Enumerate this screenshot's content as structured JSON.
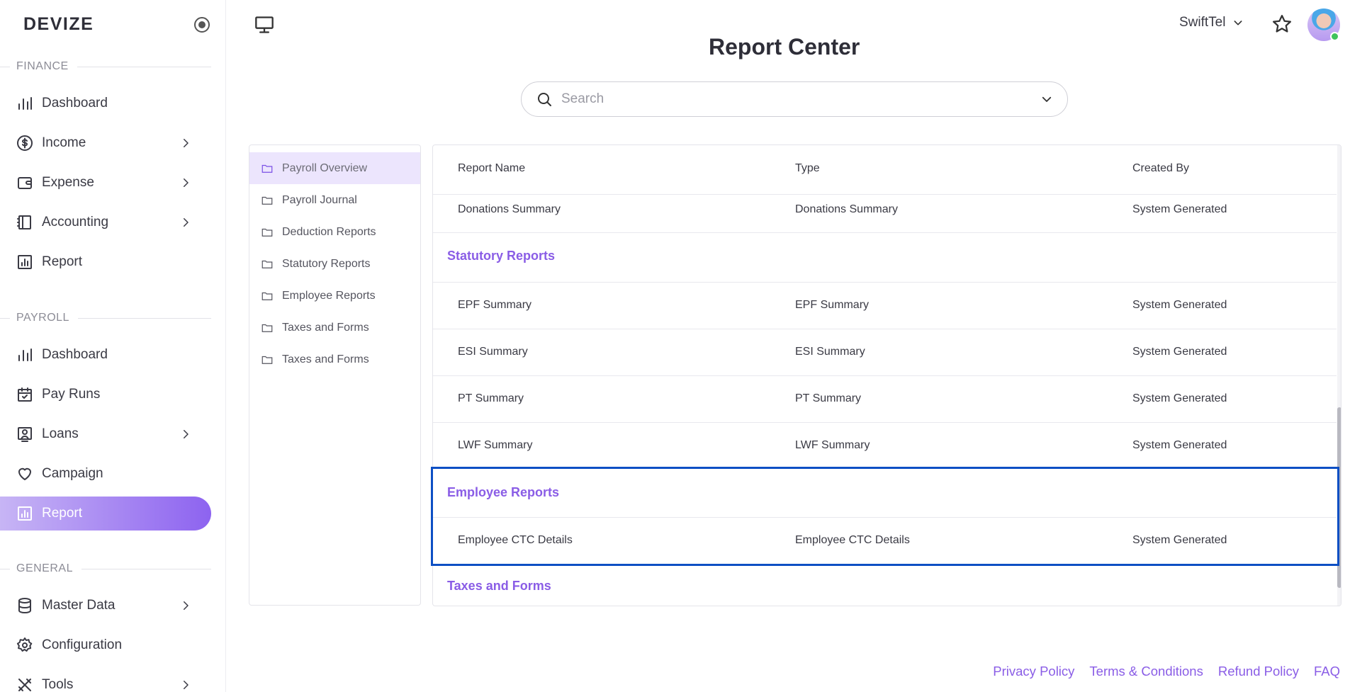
{
  "app": {
    "brand": "DEVIZE"
  },
  "sidebar": {
    "sections": [
      {
        "label": "FINANCE",
        "items": [
          {
            "label": "Dashboard",
            "icon": "bar-chart-icon",
            "has_children": false
          },
          {
            "label": "Income",
            "icon": "dollar-circle-icon",
            "has_children": true
          },
          {
            "label": "Expense",
            "icon": "wallet-icon",
            "has_children": true
          },
          {
            "label": "Accounting",
            "icon": "ledger-icon",
            "has_children": true
          },
          {
            "label": "Report",
            "icon": "report-icon",
            "has_children": false
          }
        ]
      },
      {
        "label": "PAYROLL",
        "items": [
          {
            "label": "Dashboard",
            "icon": "bar-chart-icon",
            "has_children": false
          },
          {
            "label": "Pay Runs",
            "icon": "calendar-check-icon",
            "has_children": false
          },
          {
            "label": "Loans",
            "icon": "loan-icon",
            "has_children": true
          },
          {
            "label": "Campaign",
            "icon": "heart-icon",
            "has_children": false
          },
          {
            "label": "Report",
            "icon": "report-icon",
            "has_children": false,
            "active": true
          }
        ]
      },
      {
        "label": "GENERAL",
        "items": [
          {
            "label": "Master Data",
            "icon": "database-icon",
            "has_children": true
          },
          {
            "label": "Configuration",
            "icon": "gear-icon",
            "has_children": false
          },
          {
            "label": "Tools",
            "icon": "tools-icon",
            "has_children": true
          }
        ]
      }
    ]
  },
  "header": {
    "title": "Report Center",
    "org_name": "SwiftTel"
  },
  "search": {
    "placeholder": "Search",
    "value": ""
  },
  "folders": [
    {
      "label": "Payroll Overview",
      "selected": true
    },
    {
      "label": "Payroll Journal"
    },
    {
      "label": "Deduction Reports"
    },
    {
      "label": "Statutory Reports"
    },
    {
      "label": "Employee Reports"
    },
    {
      "label": "Taxes and Forms"
    },
    {
      "label": "Taxes and Forms"
    }
  ],
  "table": {
    "columns": {
      "name": "Report Name",
      "type": "Type",
      "created_by": "Created By"
    },
    "top_row": {
      "name": "Donations Summary",
      "type": "Donations Summary",
      "created_by": "System Generated"
    },
    "groups": [
      {
        "title": "Statutory Reports",
        "rows": [
          {
            "name": "EPF Summary",
            "type": "EPF Summary",
            "created_by": "System Generated"
          },
          {
            "name": "ESI Summary",
            "type": "ESI Summary",
            "created_by": "System Generated"
          },
          {
            "name": "PT Summary",
            "type": "PT Summary",
            "created_by": "System Generated"
          },
          {
            "name": "LWF Summary",
            "type": "LWF Summary",
            "created_by": "System Generated"
          }
        ]
      },
      {
        "title": "Employee Reports",
        "rows": [
          {
            "name": "Employee CTC Details",
            "type": "Employee CTC Details",
            "created_by": "System Generated"
          }
        ]
      },
      {
        "title": "Taxes and Forms",
        "rows": []
      }
    ]
  },
  "footer": {
    "links": [
      "Privacy Policy",
      "Terms & Conditions",
      "Refund Policy",
      "FAQ"
    ]
  },
  "colors": {
    "accent": "#8a5de6",
    "highlight": "#0d4fc4",
    "online": "#3fc35c"
  }
}
